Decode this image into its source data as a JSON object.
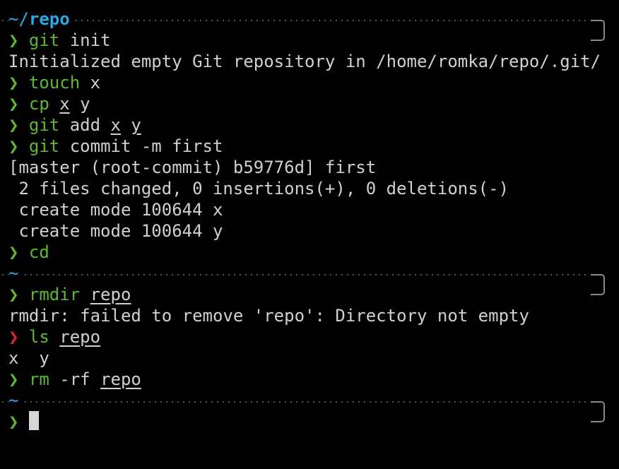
{
  "colors": {
    "background": "#000000",
    "foreground": "#d0d0d0",
    "prompt_ok": "#5fb832",
    "prompt_error": "#e8242a",
    "command": "#5fb832",
    "directory": "#2aa9e8",
    "separator": "#555555"
  },
  "prompt_symbol": "❯",
  "blocks": [
    {
      "path_prefix": "~/",
      "path_dir": "repo",
      "commands": [
        {
          "cmd": "git",
          "args": " init",
          "output": [
            "Initialized empty Git repository in /home/romka/repo/.git/"
          ]
        },
        {
          "cmd": "touch",
          "args": " x",
          "output": []
        },
        {
          "cmd": "cp",
          "arg1": "x",
          "arg2": "y",
          "output": []
        },
        {
          "cmd": "git",
          "args_pre": " add ",
          "arg1": "x",
          "arg2": "y",
          "output": []
        },
        {
          "cmd": "git",
          "args": " commit -m first",
          "output": [
            "[master (root-commit) b59776d] first",
            " 2 files changed, 0 insertions(+), 0 deletions(-)",
            " create mode 100644 x",
            " create mode 100644 y"
          ]
        },
        {
          "cmd": "cd",
          "args": "",
          "output": []
        }
      ]
    },
    {
      "path_prefix": "~",
      "path_dir": "",
      "commands": [
        {
          "cmd": "rmdir",
          "arg1": "repo",
          "output": [
            "rmdir: failed to remove 'repo': Directory not empty"
          ]
        },
        {
          "cmd": "ls",
          "arg1": "repo",
          "status": "error",
          "output": [
            "x  y"
          ]
        },
        {
          "cmd": "rm",
          "args_pre": " -rf ",
          "arg1": "repo",
          "output": []
        }
      ]
    },
    {
      "path_prefix": "~",
      "path_dir": "",
      "commands": []
    }
  ]
}
